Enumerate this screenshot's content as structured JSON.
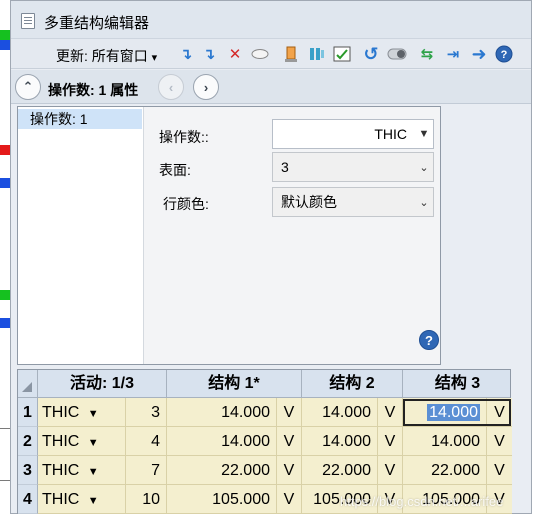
{
  "window": {
    "title": "多重结构编辑器"
  },
  "toolbar": {
    "update_label": "更新: 所有窗口",
    "update_arrow": "▾"
  },
  "nav": {
    "title": "操作数:  1 属性",
    "up_glyph": "⌃",
    "prev_glyph": "‹",
    "next_glyph": "›"
  },
  "props": {
    "list_item": "操作数: 1",
    "operand_label": "操作数::",
    "operand_value": "THIC",
    "surface_label": "表面:",
    "surface_value": "3",
    "rowcolor_label": "行颜色:",
    "rowcolor_value": "默认颜色"
  },
  "grid": {
    "headers": [
      "活动: 1/3",
      "结构 1*",
      "结构 2",
      "结构 3"
    ],
    "rows": [
      {
        "num": "1",
        "type": "THIC",
        "surf": "3",
        "c1": "14.000",
        "c2": "14.000",
        "c3": "14.000",
        "v": "V"
      },
      {
        "num": "2",
        "type": "THIC",
        "surf": "4",
        "c1": "14.000",
        "c2": "14.000",
        "c3": "14.000",
        "v": "V"
      },
      {
        "num": "3",
        "type": "THIC",
        "surf": "7",
        "c1": "22.000",
        "c2": "22.000",
        "c3": "22.000",
        "v": "V"
      },
      {
        "num": "4",
        "type": "THIC",
        "surf": "10",
        "c1": "105.000",
        "c2": "105.000",
        "c3": "105.000",
        "v": "V"
      }
    ]
  },
  "colors": {
    "accent": "#2f67b5",
    "cell_bg": "#f4efcf",
    "header_bg": "#d8e2ee",
    "selection": "#5b8fd4"
  },
  "watermark": "https://blog.csdn.net/...arifee"
}
